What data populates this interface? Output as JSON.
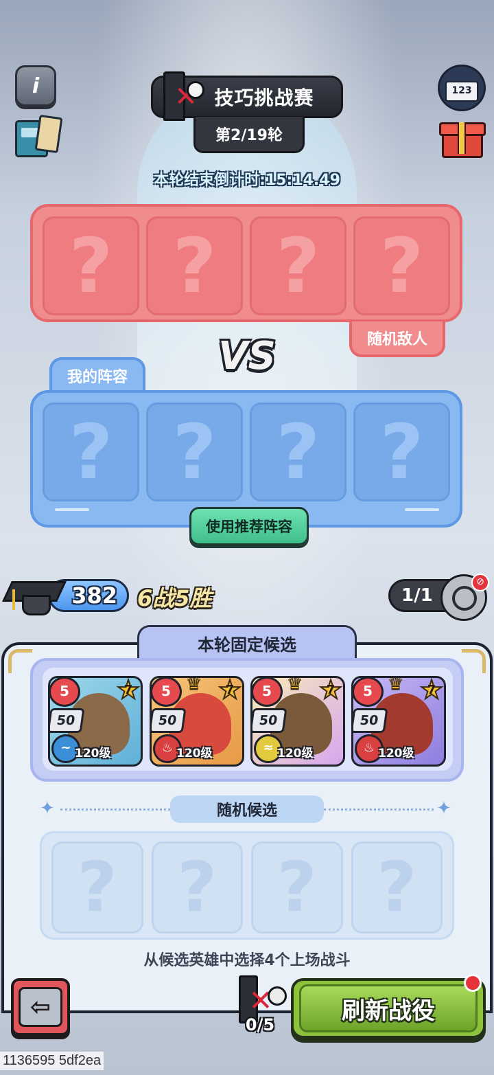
{
  "header": {
    "title": "技巧挑战赛",
    "round": "第2/19轮",
    "countdown": "本轮结束倒计时:15:14.49"
  },
  "icons": {
    "info": "i",
    "rank": "123",
    "unknown_slot": "?"
  },
  "enemy": {
    "tag": "随机敌人",
    "slots": [
      "?",
      "?",
      "?",
      "?"
    ]
  },
  "vs_label": "VS",
  "ally": {
    "tag": "我的阵容",
    "slots": [
      "?",
      "?",
      "?",
      "?"
    ],
    "recommend_button": "使用推荐阵容"
  },
  "stats": {
    "points": "382",
    "record": "6战5胜",
    "skips": "1/1"
  },
  "fixed_candidates": {
    "tab": "本轮固定候选",
    "heroes": [
      {
        "grade": "5",
        "power": "50",
        "star": "7",
        "level": "120级",
        "element": "water-icon",
        "crown": false,
        "accent": "#3b8fd8"
      },
      {
        "grade": "5",
        "power": "50",
        "star": "7",
        "level": "120级",
        "element": "fire-icon",
        "crown": true,
        "accent": "#d94040"
      },
      {
        "grade": "5",
        "power": "50",
        "star": "7",
        "level": "120级",
        "element": "wind-icon",
        "crown": true,
        "accent": "#e2c93e"
      },
      {
        "grade": "5",
        "power": "50",
        "star": "7",
        "level": "120级",
        "element": "fire-icon",
        "crown": true,
        "accent": "#d94040"
      }
    ]
  },
  "random_candidates": {
    "tab": "随机候选",
    "slots": [
      "?",
      "?",
      "?",
      "?"
    ],
    "hint": "从候选英雄中选择4个上场战斗"
  },
  "footer": {
    "back_glyph": "⇦",
    "battle_count": "0/5",
    "refresh_button": "刷新战役"
  },
  "debug_text": "1136595 5df2ea",
  "colors": {
    "enemy": "#f08c8e",
    "ally": "#8ab9f2",
    "recommend": "#3fbf8c",
    "refresh": "#8ec23d"
  }
}
